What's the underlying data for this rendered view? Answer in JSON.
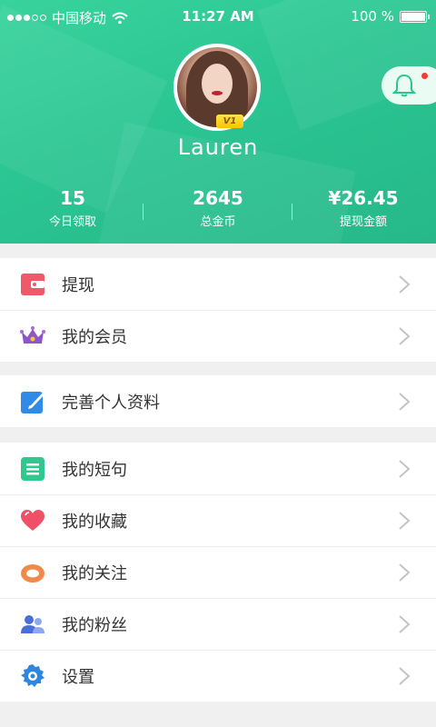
{
  "status_bar": {
    "carrier": "中国移动",
    "time": "11:27 AM",
    "battery": "100 %"
  },
  "profile": {
    "username": "Lauren",
    "vip_level": "V1"
  },
  "stats": [
    {
      "value": "15",
      "label": "今日领取"
    },
    {
      "value": "2645",
      "label": "总金币"
    },
    {
      "value": "¥26.45",
      "label": "提现金额"
    }
  ],
  "menu": {
    "group1": [
      {
        "label": "提现",
        "icon": "wallet-icon"
      },
      {
        "label": "我的会员",
        "icon": "crown-icon"
      }
    ],
    "group2": [
      {
        "label": "完善个人资料",
        "icon": "edit-profile-icon"
      }
    ],
    "group3": [
      {
        "label": "我的短句",
        "icon": "notes-icon"
      },
      {
        "label": "我的收藏",
        "icon": "heart-icon"
      },
      {
        "label": "我的关注",
        "icon": "follow-ring-icon"
      },
      {
        "label": "我的粉丝",
        "icon": "fans-icon"
      },
      {
        "label": "设置",
        "icon": "settings-gear-icon"
      }
    ]
  },
  "colors": {
    "header_green": "#2bc592",
    "badge_red": "#f23b3b"
  }
}
